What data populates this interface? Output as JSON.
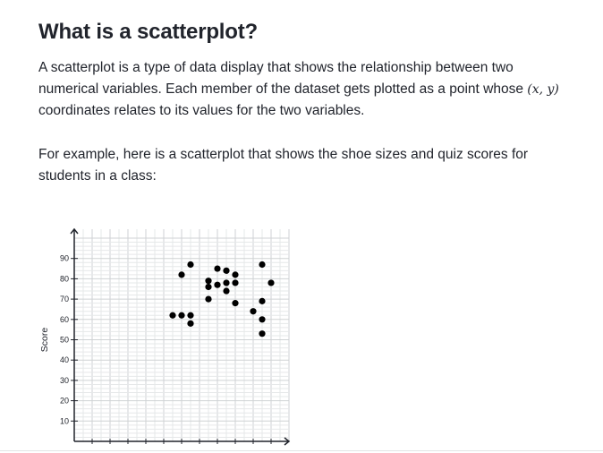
{
  "heading": "What is a scatterplot?",
  "paragraph1": {
    "before_math": "A scatterplot is a type of data display that shows the relationship between two numerical variables. Each member of the dataset gets plotted as a point whose ",
    "math": "(x, y)",
    "after_math": " coordinates relates to its values for the two variables."
  },
  "paragraph2": "For example, here is a scatterplot that shows the shoe sizes and quiz scores for students in a class:",
  "chart_data": {
    "type": "scatter",
    "ylabel": "Score",
    "xlabel": "",
    "y_ticks": [
      10,
      20,
      30,
      40,
      50,
      60,
      70,
      80,
      90
    ],
    "ylim": [
      0,
      100
    ],
    "xlim": [
      0,
      12
    ],
    "grid": true,
    "points": [
      {
        "x": 5.5,
        "y": 62
      },
      {
        "x": 6,
        "y": 62
      },
      {
        "x": 6.5,
        "y": 62
      },
      {
        "x": 6,
        "y": 82
      },
      {
        "x": 6.5,
        "y": 87
      },
      {
        "x": 6.5,
        "y": 58
      },
      {
        "x": 7.5,
        "y": 79
      },
      {
        "x": 7.5,
        "y": 76
      },
      {
        "x": 7.5,
        "y": 70
      },
      {
        "x": 8,
        "y": 85
      },
      {
        "x": 8,
        "y": 77
      },
      {
        "x": 8.5,
        "y": 84
      },
      {
        "x": 8.5,
        "y": 78
      },
      {
        "x": 8.5,
        "y": 74
      },
      {
        "x": 9,
        "y": 82
      },
      {
        "x": 9,
        "y": 78
      },
      {
        "x": 9,
        "y": 68
      },
      {
        "x": 10,
        "y": 64
      },
      {
        "x": 10.5,
        "y": 87
      },
      {
        "x": 10.5,
        "y": 69
      },
      {
        "x": 10.5,
        "y": 60
      },
      {
        "x": 10.5,
        "y": 53
      },
      {
        "x": 11,
        "y": 78
      }
    ]
  }
}
